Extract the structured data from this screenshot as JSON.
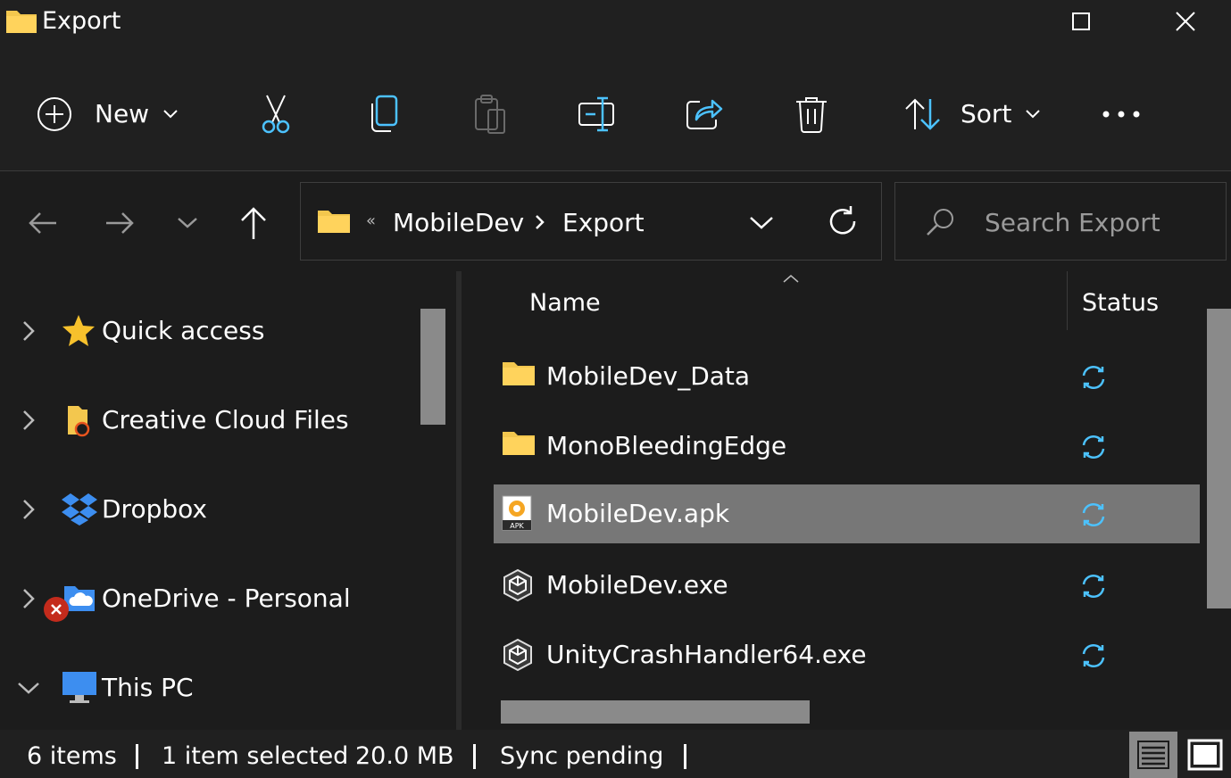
{
  "window": {
    "title": "Export"
  },
  "commandbar": {
    "new_label": "New",
    "sort_label": "Sort"
  },
  "address": {
    "overflow": "«",
    "crumbs": [
      "MobileDev",
      "Export"
    ]
  },
  "search": {
    "placeholder": "Search Export"
  },
  "sidebar": {
    "items": [
      {
        "label": "Quick access"
      },
      {
        "label": "Creative Cloud Files"
      },
      {
        "label": "Dropbox"
      },
      {
        "label": "OneDrive - Personal"
      },
      {
        "label": "This PC"
      }
    ]
  },
  "filelist": {
    "columns": {
      "name": "Name",
      "status": "Status"
    },
    "rows": [
      {
        "name": "MobileDev_Data",
        "icon": "folder-icon"
      },
      {
        "name": "MonoBleedingEdge",
        "icon": "folder-icon"
      },
      {
        "name": "MobileDev.apk",
        "icon": "apk-file-icon",
        "icon_text": "APK",
        "selected": true
      },
      {
        "name": "MobileDev.exe",
        "icon": "unity-app-icon"
      },
      {
        "name": "UnityCrashHandler64.exe",
        "icon": "unity-app-icon"
      }
    ]
  },
  "statusbar": {
    "count": "6 items",
    "selection": "1 item selected",
    "size": "20.0 MB",
    "sync": "Sync pending"
  },
  "colors": {
    "accent": "#4cc2ff",
    "folder": "#f3c74e",
    "selection": "#777777",
    "error": "#c42b1c"
  }
}
